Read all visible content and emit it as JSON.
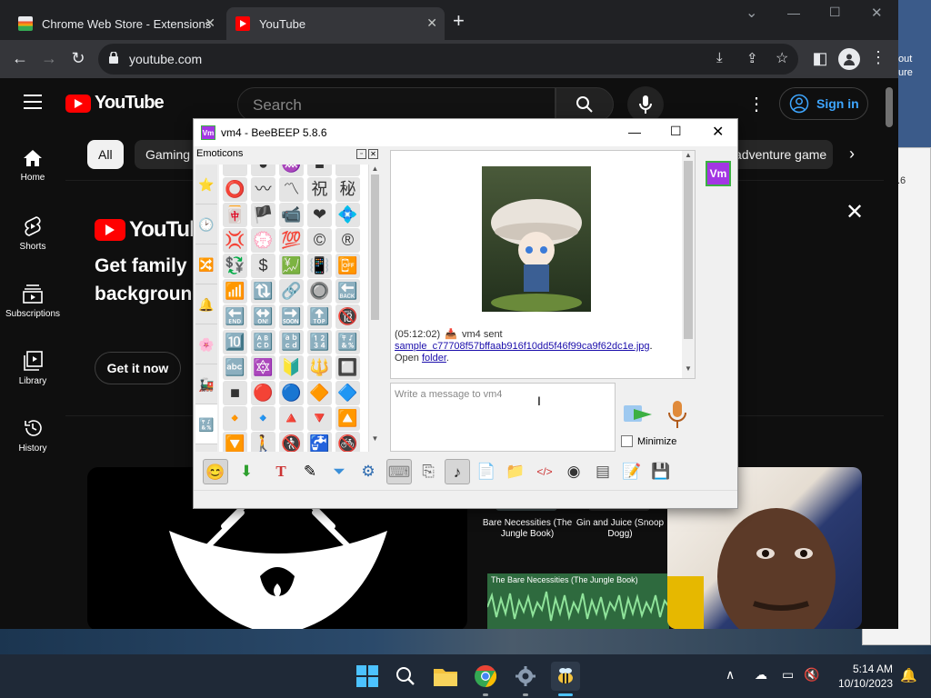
{
  "browser": {
    "tabs": [
      {
        "title": "Chrome Web Store - Extensions"
      },
      {
        "title": "YouTube"
      }
    ],
    "new_tab": "+",
    "window_controls": {
      "minimize": "—",
      "maximize": "☐",
      "close": "✕",
      "dropdown": "⌄"
    },
    "url": "youtube.com"
  },
  "youtube": {
    "logo_text": "YouTube",
    "search_placeholder": "Search",
    "sign_in": "Sign in",
    "nav": [
      {
        "label": "Home"
      },
      {
        "label": "Shorts"
      },
      {
        "label": "Subscriptions"
      },
      {
        "label": "Library"
      },
      {
        "label": "History"
      }
    ],
    "chips": [
      "All",
      "Gaming",
      "adventure game"
    ],
    "banner": {
      "logo_text": "YouTube",
      "headline_1": "Get family p",
      "headline_2": "backgroun",
      "cta": "Get it now"
    },
    "video_cards": [
      {
        "title": "Bare Necessities (The Jungle Book)"
      },
      {
        "title": "Gin and Juice (Snoop Dogg)"
      }
    ],
    "waveform_label": "The Bare Necessities (The Jungle Book)"
  },
  "behind_window": {
    "text_1": "out",
    "text_2": "ure",
    "version": ".6"
  },
  "beebeep": {
    "title": "vm4 - BeeBEEP 5.8.6",
    "app_badge": "Vm",
    "emoticons_title": "Emoticons",
    "user_badge": "Vm",
    "message": {
      "time": "(05:12:02)",
      "sender_text": "vm4 sent",
      "file_link": "sample_c77708f57bffaab916f10dd5f46f99ca9f62dc1e.jpg",
      "after_link": ".",
      "open_label": "Open",
      "folder_link": "folder",
      "folder_after": "."
    },
    "input_placeholder": "Write a message to vm4",
    "minimize_label": "Minimize",
    "emoji_rows": [
      [
        "",
        "●",
        "♒",
        "■",
        ""
      ],
      [
        "⭕",
        "〰",
        "〽",
        "祝",
        "秘"
      ],
      [
        "🀄",
        "🏴",
        "📹",
        "❤",
        "💠"
      ],
      [
        "💢",
        "💮",
        "💯",
        "©",
        "®"
      ],
      [
        "💱",
        "$",
        "💹",
        "📳",
        "📴"
      ],
      [
        "📶",
        "🔃",
        "🔗",
        "🔘",
        "🔙"
      ],
      [
        "🔚",
        "🔛",
        "🔜",
        "🔝",
        "🔞"
      ],
      [
        "🔟",
        "🔠",
        "🔡",
        "🔢",
        "🔣"
      ],
      [
        "🔤",
        "🔯",
        "🔰",
        "🔱",
        "🔲"
      ],
      [
        "■",
        "🔴",
        "🔵",
        "🔶",
        "🔷"
      ],
      [
        "🔸",
        "🔹",
        "🔺",
        "🔻",
        "🔼"
      ],
      [
        "🔽",
        "🚶",
        "🚷",
        "🚰",
        "🚳"
      ]
    ],
    "category_icons": [
      "⭐",
      "🕑",
      "🔀",
      "🔔",
      "🌸",
      "🚂",
      "🔣"
    ]
  },
  "taskbar": {
    "time": "5:14 AM",
    "date": "10/10/2023"
  },
  "colors": {
    "youtube_red": "#ff0000",
    "chrome_dark": "#202124",
    "link_blue": "#1a0dab",
    "sign_in_blue": "#3ea6ff",
    "beebeep_badge": "#a336e3"
  }
}
